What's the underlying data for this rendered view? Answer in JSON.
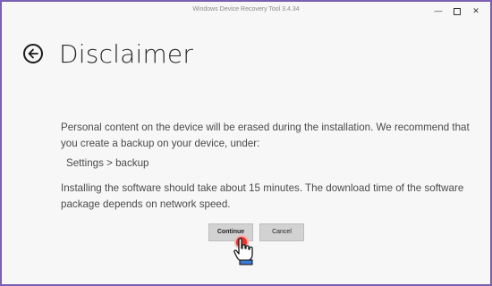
{
  "window": {
    "title": "Windows Device Recovery Tool 3.4.34",
    "minimize_icon": "minimize-icon",
    "maximize_icon": "maximize-icon",
    "close_icon": "close-icon"
  },
  "header": {
    "back_icon": "back-arrow-icon",
    "title": "Disclaimer"
  },
  "content": {
    "paragraph1": "Personal content on the device will be erased during the installation. We recommend that you create a backup on your device, under:",
    "path": "Settings > backup",
    "paragraph2": "Installing the software should take about 15 minutes. The download time of the software package depends on network speed."
  },
  "actions": {
    "continue_label": "Continue",
    "cancel_label": "Cancel"
  },
  "colors": {
    "frame": "#7b5fb0",
    "background": "#f7f7f7",
    "button": "#d2d2d2",
    "click_indicator": "#e8322f"
  }
}
